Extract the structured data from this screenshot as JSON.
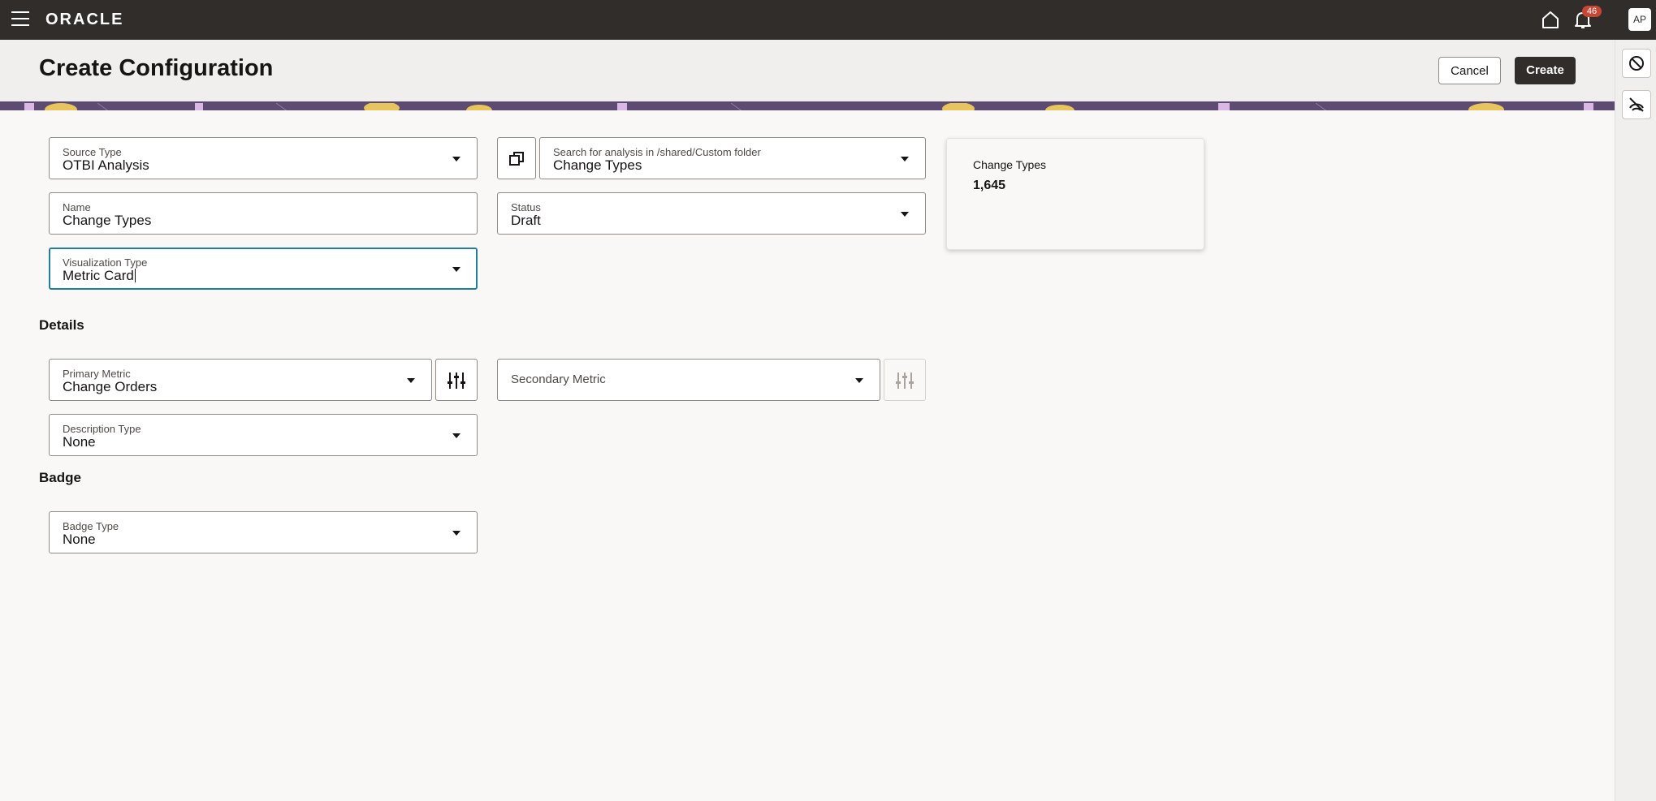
{
  "app": {
    "logo": "ORACLE",
    "avatar": "AP",
    "notification_count": "46"
  },
  "page": {
    "title": "Create Configuration",
    "cancel_label": "Cancel",
    "create_label": "Create"
  },
  "form": {
    "source_type": {
      "label": "Source Type",
      "value": "OTBI Analysis"
    },
    "search_analysis": {
      "label": "Search for analysis in /shared/Custom folder",
      "value": "Change Types"
    },
    "name": {
      "label": "Name",
      "value": "Change Types"
    },
    "status": {
      "label": "Status",
      "value": "Draft"
    },
    "visualization_type": {
      "label": "Visualization Type",
      "value": "Metric Card"
    }
  },
  "details": {
    "title": "Details",
    "primary_metric": {
      "label": "Primary Metric",
      "value": "Change Orders"
    },
    "secondary_metric": {
      "placeholder": "Secondary Metric"
    },
    "description_type": {
      "label": "Description Type",
      "value": "None"
    }
  },
  "badge": {
    "title": "Badge",
    "badge_type": {
      "label": "Badge Type",
      "value": "None"
    }
  },
  "preview": {
    "label": "Change Types",
    "value": "1,645"
  },
  "icons": [
    "menu-icon",
    "home-icon",
    "bell-icon",
    "copy-icon",
    "sliders-icon",
    "block-icon",
    "no-wifi-icon"
  ]
}
